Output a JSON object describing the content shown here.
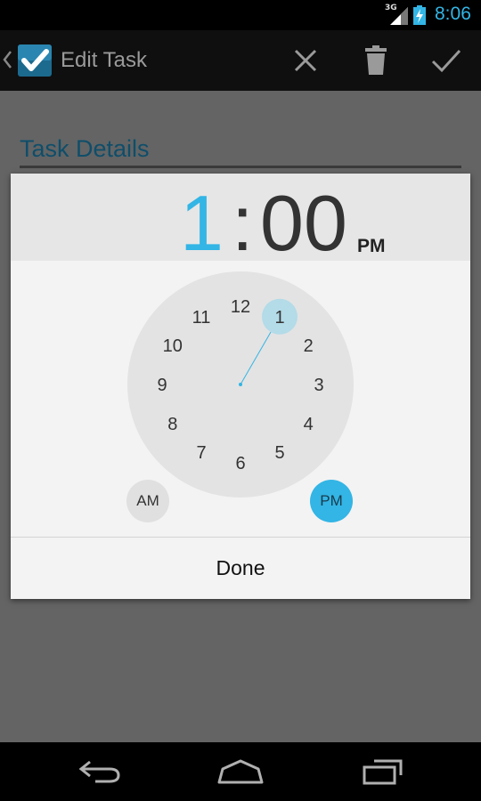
{
  "status_bar": {
    "network": "3G",
    "time": "8:06"
  },
  "action_bar": {
    "title": "Edit Task"
  },
  "content": {
    "section_title": "Task Details"
  },
  "time_picker": {
    "hour": "1",
    "colon": ":",
    "minutes": "00",
    "ampm": "PM",
    "dial_numbers": [
      "12",
      "1",
      "2",
      "3",
      "4",
      "5",
      "6",
      "7",
      "8",
      "9",
      "10",
      "11"
    ],
    "selected_hour": 1,
    "am_label": "AM",
    "pm_label": "PM",
    "selected_period": "PM",
    "done_label": "Done"
  },
  "colors": {
    "accent": "#33b5e5",
    "title_blue": "#0f4e6a",
    "dial_bg": "#e3e3e3"
  },
  "icons": [
    "back-caret-icon",
    "app-check-icon",
    "close-icon",
    "trash-icon",
    "check-icon",
    "nav-back-icon",
    "nav-home-icon",
    "nav-recent-icon"
  ]
}
